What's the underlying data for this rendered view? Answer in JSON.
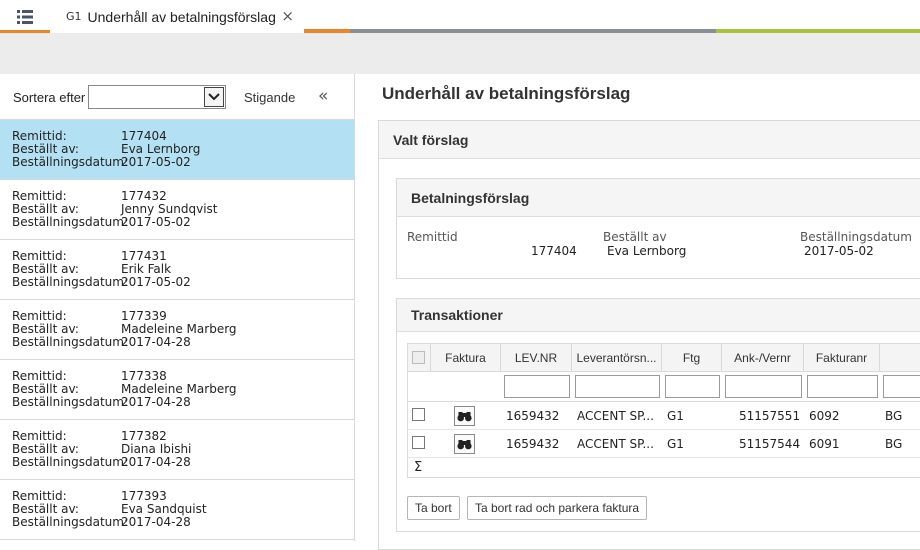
{
  "tab": {
    "code": "G1",
    "title": "Underhåll av betalningsförslag",
    "close": "×"
  },
  "colors": {
    "accent_orange": "#e8862a",
    "accent_gray": "#8a8f96",
    "accent_green": "#a6c53a",
    "selected": "#b3e1f3"
  },
  "sort": {
    "label": "Sortera efter",
    "value": "",
    "order": "Stigande",
    "collapse": "«"
  },
  "list_labels": {
    "remittid": "Remittid:",
    "bestallt_av": "Beställt av:",
    "datum": "Beställningsdatum:"
  },
  "list": [
    {
      "remittid": "177404",
      "bestallt_av": "Eva Lernborg",
      "datum": "2017-05-02",
      "selected": true
    },
    {
      "remittid": "177432",
      "bestallt_av": "Jenny Sundqvist",
      "datum": "2017-05-02"
    },
    {
      "remittid": "177431",
      "bestallt_av": "Erik Falk",
      "datum": "2017-05-02"
    },
    {
      "remittid": "177339",
      "bestallt_av": "Madeleine Marberg",
      "datum": "2017-04-28"
    },
    {
      "remittid": "177338",
      "bestallt_av": "Madeleine Marberg",
      "datum": "2017-04-28"
    },
    {
      "remittid": "177382",
      "bestallt_av": "Diana Ibishi",
      "datum": "2017-04-28"
    },
    {
      "remittid": "177393",
      "bestallt_av": "Eva Sandquist",
      "datum": "2017-04-28"
    }
  ],
  "main": {
    "title": "Underhåll av betalningsförslag",
    "valt_forslag": "Valt förslag",
    "betal": {
      "title": "Betalningsförslag",
      "remittid_label": "Remittid",
      "remittid": "177404",
      "bestallt_label": "Beställt av",
      "bestallt": "Eva Lernborg",
      "datum_label": "Beställningsdatum",
      "datum": "2017-05-02"
    },
    "trans": {
      "title": "Transaktioner",
      "columns": [
        "Faktura",
        "LEV.NR",
        "Leverantörsn...",
        "Ftg",
        "Ank-/Vernr",
        "Fakturanr"
      ],
      "rows": [
        {
          "levnr": "1659432",
          "lev": "ACCENT SP...",
          "ftg": "G1",
          "vernr": "51157551",
          "fakturanr": "6092",
          "extra": "BG"
        },
        {
          "levnr": "1659432",
          "lev": "ACCENT SP...",
          "ftg": "G1",
          "vernr": "51157544",
          "fakturanr": "6091",
          "extra": "BG"
        }
      ],
      "sum_symbol": "Σ",
      "btn_delete": "Ta bort",
      "btn_delete_park": "Ta bort rad och parkera faktura"
    }
  }
}
